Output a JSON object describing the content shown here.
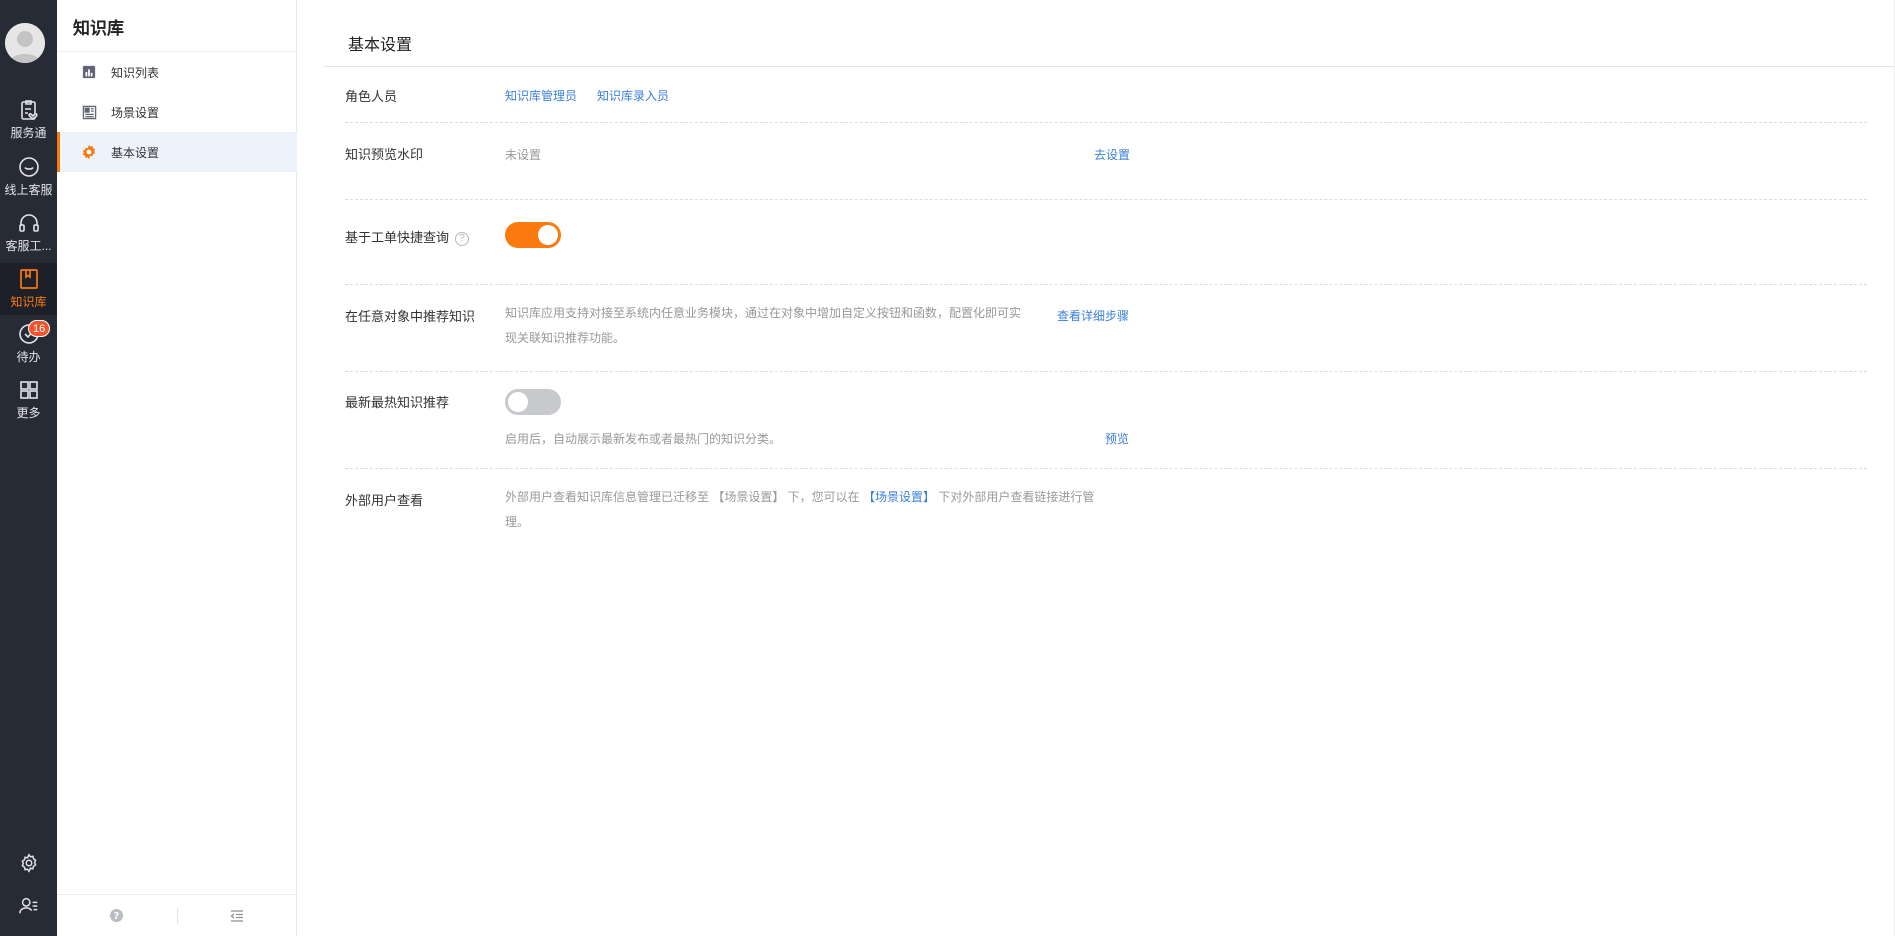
{
  "rail": {
    "items": [
      {
        "label": "服务通",
        "icon": "clipboard-heart-icon"
      },
      {
        "label": "线上客服",
        "icon": "smile-chat-icon"
      },
      {
        "label": "客服工...",
        "icon": "headset-icon"
      },
      {
        "label": "知识库",
        "icon": "book-icon",
        "active": true
      },
      {
        "label": "待办",
        "icon": "check-circle-icon",
        "badge": "16"
      },
      {
        "label": "更多",
        "icon": "grid-icon"
      }
    ],
    "bottom": [
      {
        "icon": "gear-icon"
      },
      {
        "icon": "user-list-icon"
      }
    ],
    "accent_color": "#fa7a0e",
    "background": "#262b36"
  },
  "sidebar": {
    "title": "知识库",
    "items": [
      {
        "label": "知识列表",
        "icon": "bar-chart-icon"
      },
      {
        "label": "场景设置",
        "icon": "layout-icon"
      },
      {
        "label": "基本设置",
        "icon": "gear-icon",
        "active": true
      }
    ],
    "footer": [
      {
        "icon": "help-icon"
      },
      {
        "icon": "collapse-menu-icon"
      }
    ]
  },
  "main": {
    "title": "基本设置",
    "roles": {
      "label": "角色人员",
      "links": [
        "知识库管理员",
        "知识库录入员"
      ]
    },
    "watermark": {
      "label": "知识预览水印",
      "value": "未设置",
      "action": "去设置"
    },
    "quick_query": {
      "label": "基于工单快捷查询",
      "help": "?",
      "enabled": true
    },
    "recommend": {
      "label": "在任意对象中推荐知识",
      "desc_line1": "知识库应用支持对接至系统内任意业务模块，通过在对象中增加自定义按钮和函数，配置化即可实",
      "desc_line2": "现关联知识推荐功能。",
      "action": "查看详细步骤"
    },
    "hot": {
      "label": "最新最热知识推荐",
      "enabled": false,
      "desc": "启用后，自动展示最新发布或者最热门的知识分类。",
      "action": "预览"
    },
    "external": {
      "label": "外部用户查看",
      "desc_part1": "外部用户查看知识库信息管理已迁移至 【场景设置】 下，您可以在 ",
      "link": "【场景设置】",
      "desc_part2": " 下对外部用户查看链接进行管",
      "desc_line2": "理。"
    }
  },
  "colors": {
    "accent": "#fa7a0e",
    "link": "#3a7fdc",
    "badge": "#f2542d"
  }
}
